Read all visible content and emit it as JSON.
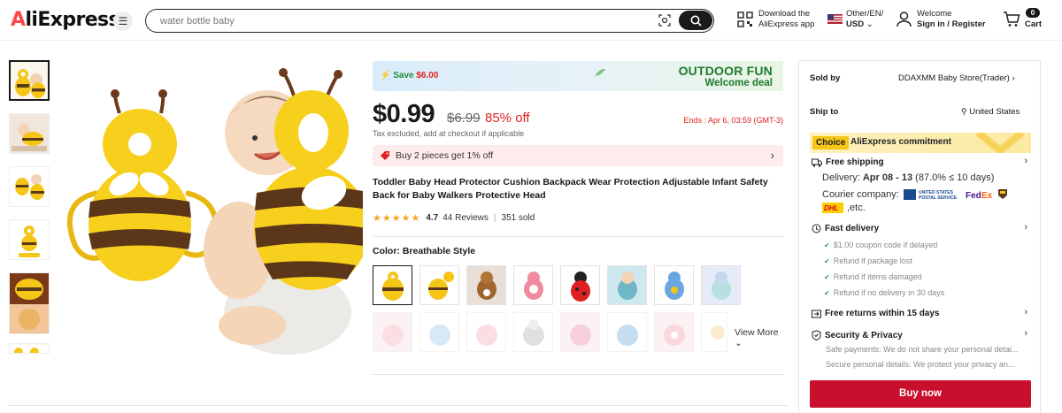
{
  "header": {
    "logo": "AliExpress",
    "search_placeholder": "water bottle baby",
    "download_line1": "Download the",
    "download_line2": "AliExpress app",
    "region_line1": "Other/EN/",
    "region_line2": "USD",
    "account_line1": "Welcome",
    "account_line2": "Sign in / Register",
    "cart_count": "0",
    "cart_label": "Cart"
  },
  "deal_banner": {
    "save_label": "Save",
    "save_amount": "$6.00",
    "line1": "OUTDOOR FUN",
    "line2": "Welcome deal"
  },
  "product": {
    "price": "$0.99",
    "original_price": "$6.99",
    "discount": "85% off",
    "ends": "Ends : Apr 6, 03:59 (GMT-3)",
    "tax_note": "Tax excluded, add at checkout if applicable",
    "promo": "Buy 2 pieces get 1% off",
    "title": "Toddler Baby Head Protector Cushion Backpack Wear Protection Adjustable Infant Safety Back for Baby Walkers Protective Head",
    "rating": "4.7",
    "reviews": "44 Reviews",
    "sold": "351 sold",
    "color_label": "Color: Breathable Style",
    "view_more": "View More"
  },
  "panel": {
    "sold_by_label": "Sold by",
    "sold_by_value": "DDAXMM Baby Store(Trader)",
    "ship_to_label": "Ship to",
    "ship_to_value": "United States",
    "choice_tag": "Choice",
    "choice_text": "AliExpress commitment",
    "free_shipping": "Free shipping",
    "delivery_label": "Delivery:",
    "delivery_dates": "Apr 08 - 13",
    "delivery_pct": "(87.0% ≤ 10 days)",
    "courier_label": "Courier company:",
    "courier_etc": ",etc.",
    "fast_delivery": "Fast delivery",
    "fast_items": [
      "$1.00 coupon code if delayed",
      "Refund if package lost",
      "Refund if items damaged",
      "Refund if no delivery in 30 days"
    ],
    "free_returns": "Free returns within 15 days",
    "security": "Security & Privacy",
    "security_items": [
      "Safe payments: We do not share your personal detai...",
      "Secure personal details: We protect your privacy an..."
    ],
    "buy_now": "Buy now"
  },
  "colors": {
    "accent_red": "#e02020",
    "buy_button": "#c8102e",
    "deal_green": "#1d7a2c",
    "star": "#f5a623"
  }
}
